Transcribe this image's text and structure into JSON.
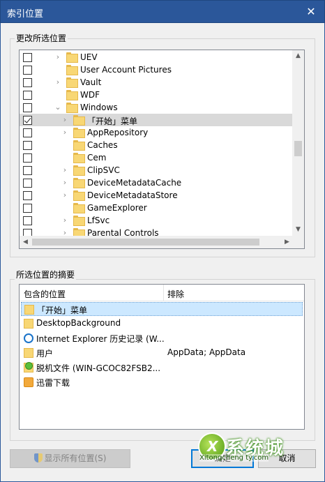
{
  "window": {
    "title": "索引位置",
    "close_glyph": "✕"
  },
  "change_group": {
    "label": "更改所选位置",
    "tree": [
      {
        "label": "UEV",
        "checked": false,
        "expander": "›",
        "selected": false
      },
      {
        "label": "User Account Pictures",
        "checked": false,
        "expander": "",
        "selected": false
      },
      {
        "label": "Vault",
        "checked": false,
        "expander": "›",
        "selected": false
      },
      {
        "label": "WDF",
        "checked": false,
        "expander": "",
        "selected": false
      },
      {
        "label": "Windows",
        "checked": false,
        "expander": "⌄",
        "selected": false
      },
      {
        "label": "「开始」菜单",
        "checked": true,
        "expander": "›",
        "selected": true
      },
      {
        "label": "AppRepository",
        "checked": false,
        "expander": "›",
        "selected": false
      },
      {
        "label": "Caches",
        "checked": false,
        "expander": "",
        "selected": false
      },
      {
        "label": "Cem",
        "checked": false,
        "expander": "",
        "selected": false
      },
      {
        "label": "ClipSVC",
        "checked": false,
        "expander": "›",
        "selected": false
      },
      {
        "label": "DeviceMetadataCache",
        "checked": false,
        "expander": "›",
        "selected": false
      },
      {
        "label": "DeviceMetadataStore",
        "checked": false,
        "expander": "›",
        "selected": false
      },
      {
        "label": "GameExplorer",
        "checked": false,
        "expander": "",
        "selected": false
      },
      {
        "label": "LfSvc",
        "checked": false,
        "expander": "›",
        "selected": false
      },
      {
        "label": "Parental Controls",
        "checked": false,
        "expander": "›",
        "selected": false
      }
    ]
  },
  "summary_group": {
    "label": "所选位置的摘要",
    "columns": {
      "location": "包含的位置",
      "exclude": "排除"
    },
    "rows": [
      {
        "icon": "folder-icon",
        "location": "「开始」菜单",
        "exclude": "",
        "selected": true
      },
      {
        "icon": "folder-icon",
        "location": "DesktopBackground",
        "exclude": "",
        "selected": false
      },
      {
        "icon": "internet-explorer-icon",
        "location": "Internet Explorer 历史记录 (W...",
        "exclude": "",
        "selected": false
      },
      {
        "icon": "folder-icon",
        "location": "用户",
        "exclude": "AppData; AppData",
        "selected": false
      },
      {
        "icon": "offline-files-icon",
        "location": "脱机文件 (WIN-GCOC82FSB2...",
        "exclude": "",
        "selected": false
      },
      {
        "icon": "xunlei-icon",
        "location": "迅雷下载",
        "exclude": "",
        "selected": false
      }
    ]
  },
  "buttons": {
    "show_all": "显示所有位置(S)",
    "ok": "确定",
    "cancel": "取消"
  },
  "watermark": {
    "cn": "系统城",
    "en": "Xitongcheng ty.com"
  }
}
